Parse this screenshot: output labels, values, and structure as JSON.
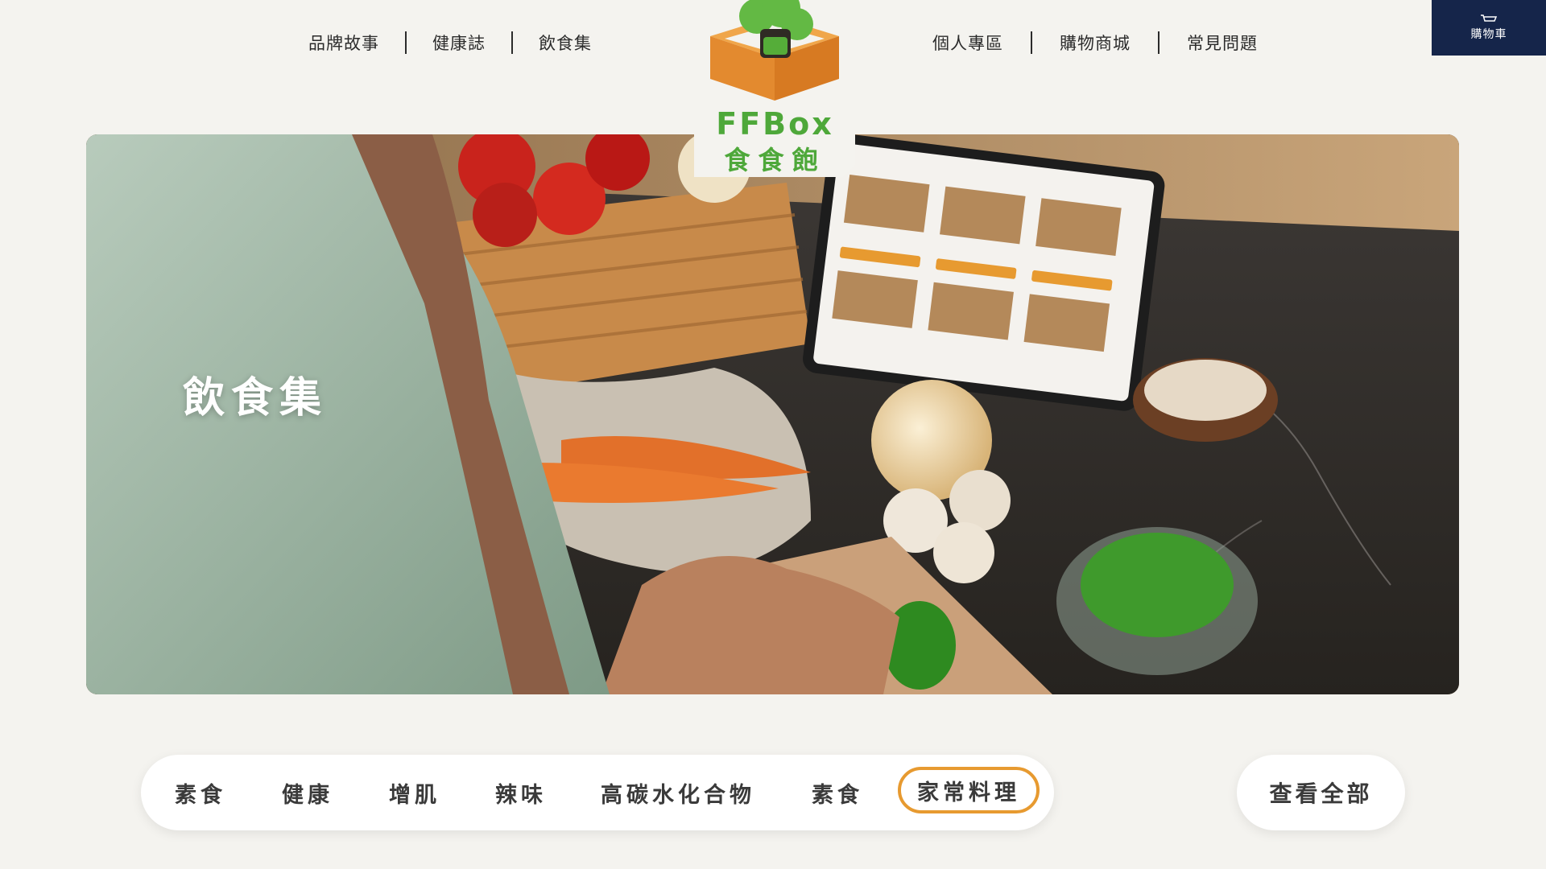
{
  "nav": {
    "left": [
      "品牌故事",
      "健康誌",
      "飲食集"
    ],
    "right": [
      "個人專區",
      "購物商城",
      "常見問題"
    ]
  },
  "cart": {
    "label": "購物車",
    "icon": "cart-icon"
  },
  "logo": {
    "en": "FFBox",
    "zh": "食食飽",
    "colors": {
      "green": "#4ea83a",
      "box": "#e38a2f"
    }
  },
  "hero": {
    "title": "飲食集"
  },
  "categories": {
    "items": [
      "素食",
      "健康",
      "增肌",
      "辣味",
      "高碳水化合物",
      "素食",
      "家常料理"
    ],
    "active_index": 6
  },
  "view_all": "查看全部",
  "colors": {
    "accent": "#e79a30",
    "navy": "#15254a",
    "background": "#f4f3ef"
  }
}
